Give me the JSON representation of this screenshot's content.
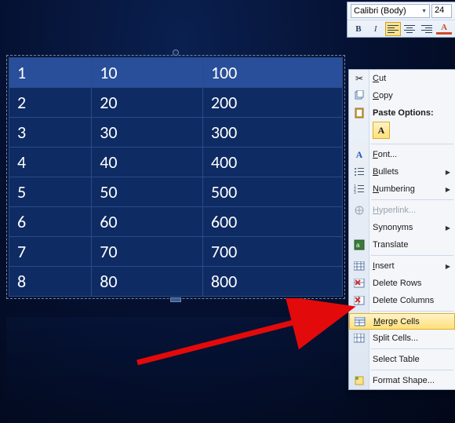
{
  "toolbar": {
    "font_name": "Calibri (Body)",
    "font_size": "24",
    "bold": "B",
    "italic": "I",
    "color_glyph": "A"
  },
  "table": {
    "rows": [
      [
        "1",
        "10",
        "100"
      ],
      [
        "2",
        "20",
        "200"
      ],
      [
        "3",
        "30",
        "300"
      ],
      [
        "4",
        "40",
        "400"
      ],
      [
        "5",
        "50",
        "500"
      ],
      [
        "6",
        "60",
        "600"
      ],
      [
        "7",
        "70",
        "700"
      ],
      [
        "8",
        "80",
        "800"
      ]
    ],
    "selected_row_index": 0
  },
  "context_menu": {
    "cut": "Cut",
    "copy": "Copy",
    "paste_header": "Paste Options:",
    "paste_opt_glyph": "A",
    "font": "Font...",
    "bullets": "Bullets",
    "numbering": "Numbering",
    "hyperlink": "Hyperlink...",
    "synonyms": "Synonyms",
    "translate": "Translate",
    "insert": "Insert",
    "delete_rows": "Delete Rows",
    "delete_columns": "Delete Columns",
    "merge_cells": "Merge Cells",
    "split_cells": "Split Cells...",
    "select_table": "Select Table",
    "format_shape": "Format Shape..."
  },
  "chart_data": {
    "type": "table",
    "rows": [
      [
        "1",
        "10",
        "100"
      ],
      [
        "2",
        "20",
        "200"
      ],
      [
        "3",
        "30",
        "300"
      ],
      [
        "4",
        "40",
        "400"
      ],
      [
        "5",
        "50",
        "500"
      ],
      [
        "6",
        "60",
        "600"
      ],
      [
        "7",
        "70",
        "700"
      ],
      [
        "8",
        "80",
        "800"
      ]
    ]
  }
}
